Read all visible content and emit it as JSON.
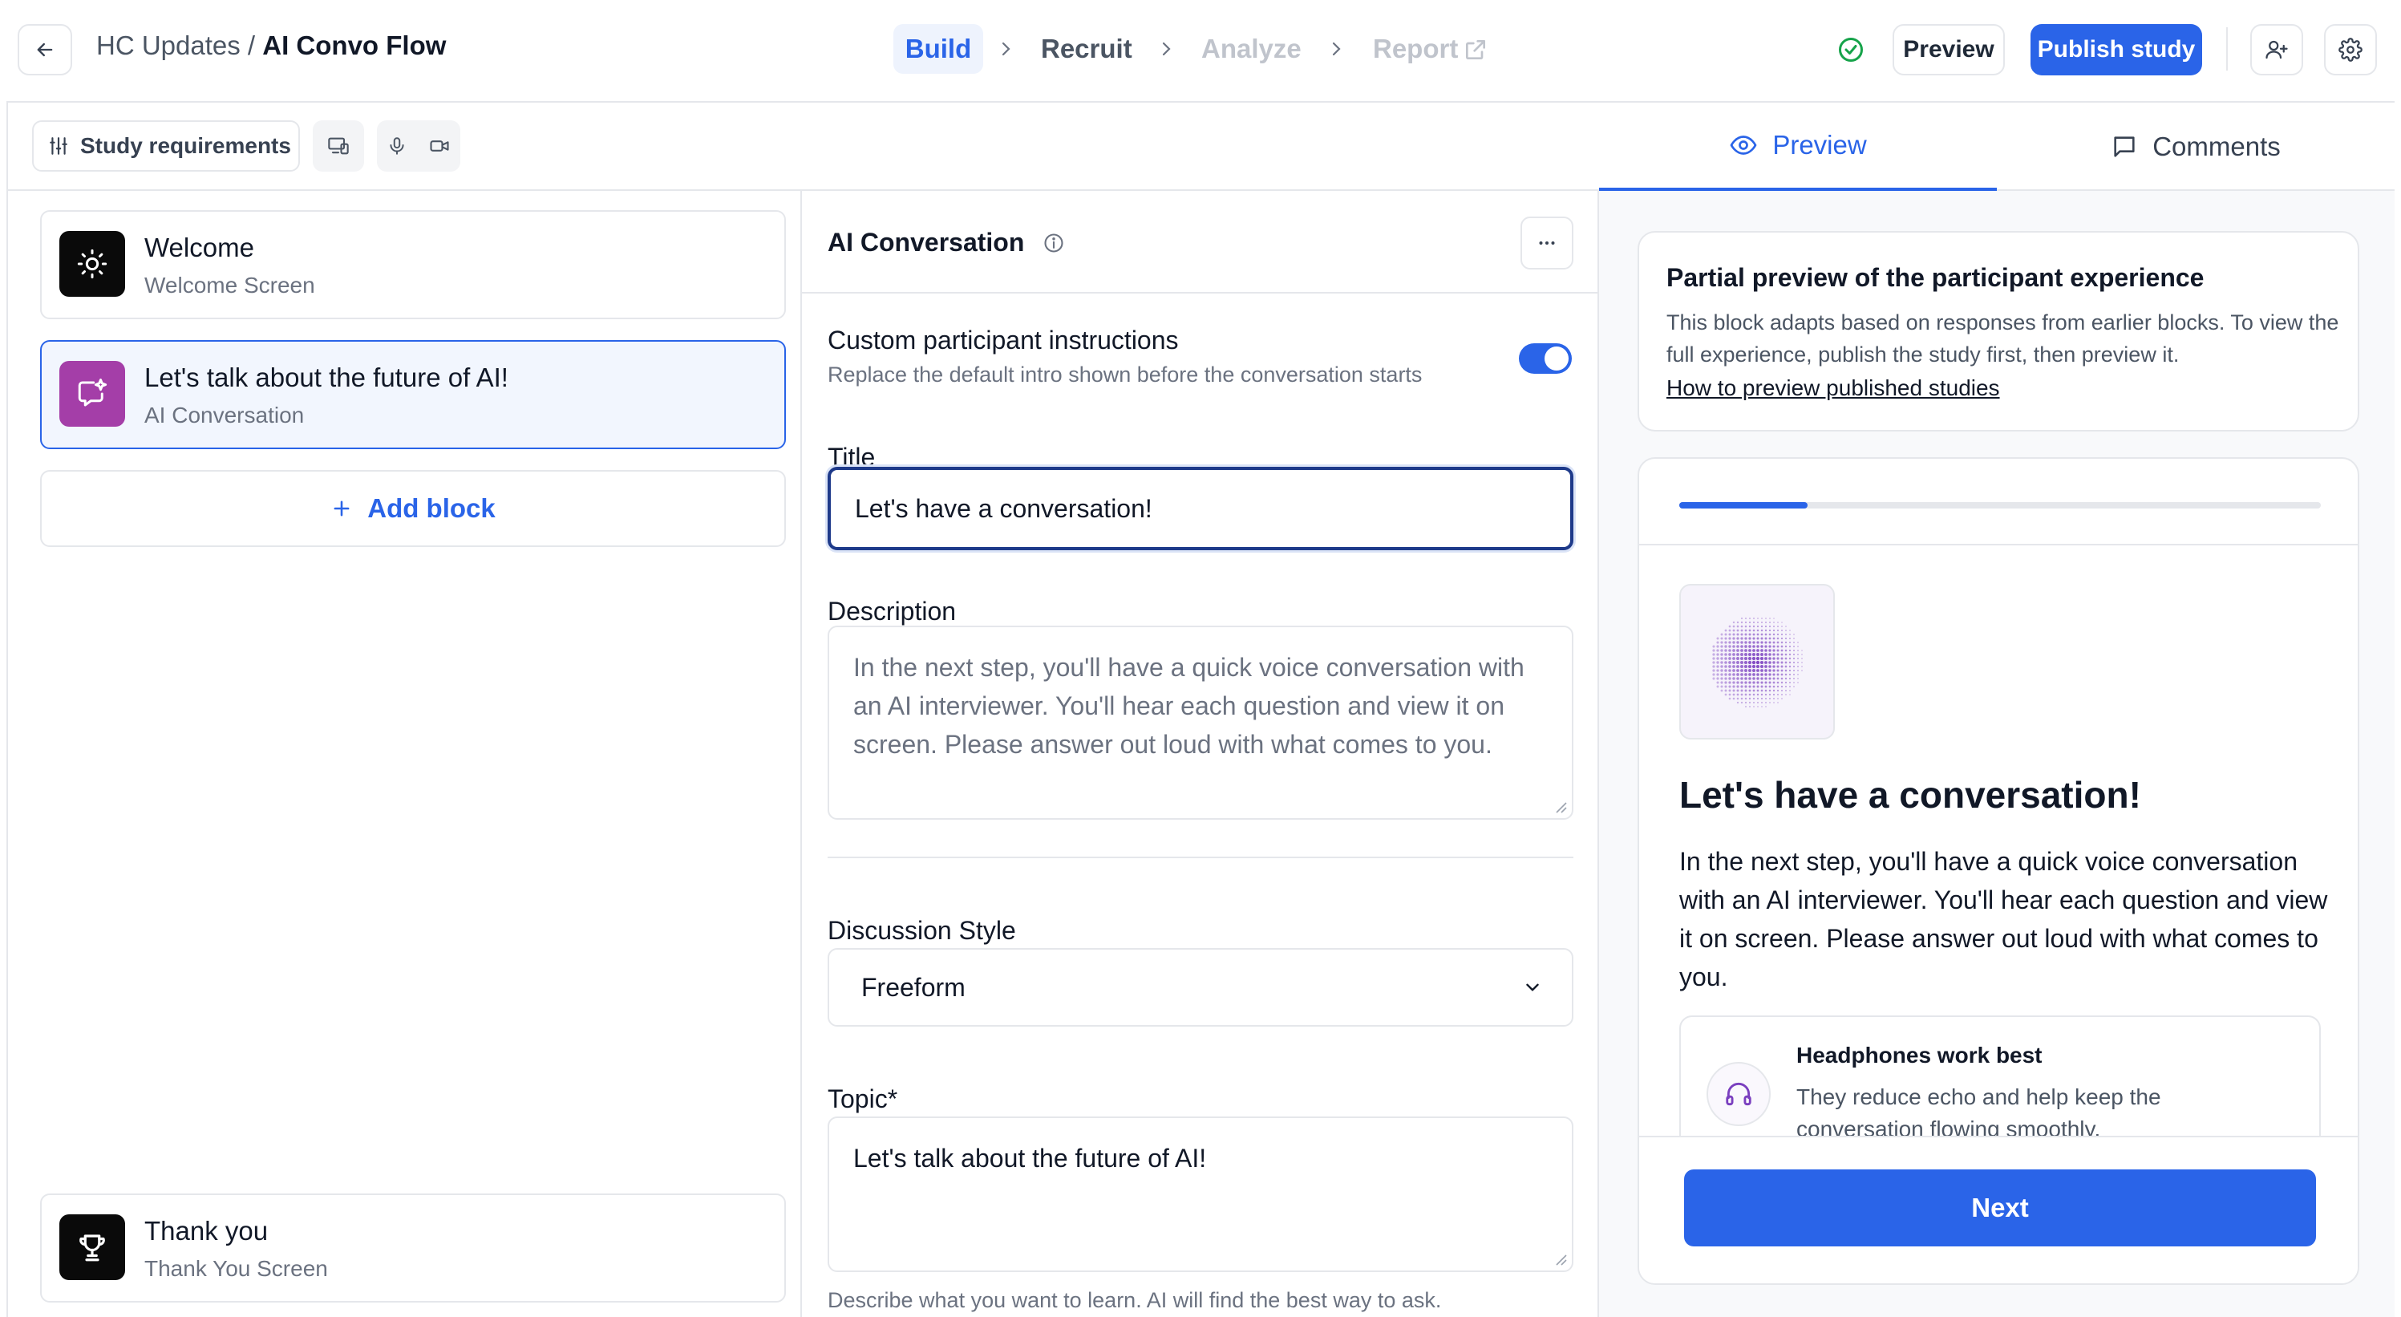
{
  "header": {
    "project": "HC Updates",
    "separator": " / ",
    "study": "AI Convo Flow",
    "steps": [
      {
        "label": "Build",
        "state": "active"
      },
      {
        "label": "Recruit",
        "state": "enabled"
      },
      {
        "label": "Analyze",
        "state": "disabled"
      },
      {
        "label": "Report",
        "state": "disabled"
      }
    ],
    "preview_label": "Preview",
    "publish_label": "Publish study",
    "icons": {
      "back": "arrow-left-icon",
      "saved": "check-circle-icon",
      "invite": "user-plus-icon",
      "settings": "gear-icon",
      "external": "external-link-icon",
      "chevron": "chevron-right-icon"
    }
  },
  "toolbar": {
    "requirements_label": "Study requirements",
    "icons": [
      "sliders-icon",
      "devices-icon",
      "microphone-icon",
      "camera-icon"
    ]
  },
  "blocks": [
    {
      "title": "Welcome",
      "subtitle": "Welcome Screen",
      "icon": "sun-icon",
      "icon_color": "#0a0a0a"
    },
    {
      "title": "Let's talk about the future of AI!",
      "subtitle": "AI Conversation",
      "icon": "sparkle-chat-icon",
      "icon_color": "#a43ea8",
      "selected": true
    },
    {
      "title": "Thank you",
      "subtitle": "Thank You Screen",
      "icon": "trophy-icon",
      "icon_color": "#0a0a0a"
    }
  ],
  "add_block_label": "Add block",
  "editor": {
    "title": "AI Conversation",
    "custom_instructions_label": "Custom participant instructions",
    "custom_instructions_hint": "Replace the default intro shown before the conversation starts",
    "custom_instructions_enabled": true,
    "title_label": "Title",
    "title_value": "Let's have a conversation!",
    "description_label": "Description",
    "description_placeholder": "In the next step, you'll have a quick voice conversation with an AI interviewer. You'll hear each question and view it on screen. Please answer out loud with what comes to you.",
    "discussion_style_label": "Discussion Style",
    "discussion_style_value": "Freeform",
    "topic_label": "Topic*",
    "topic_value": "Let's talk about the future of AI!",
    "topic_hint": "Describe what you want to learn. AI will find the best way to ask."
  },
  "preview_panel": {
    "tabs": [
      {
        "label": "Preview",
        "icon": "eye-icon",
        "active": true
      },
      {
        "label": "Comments",
        "icon": "comment-icon",
        "active": false
      }
    ],
    "info_title": "Partial preview of the participant experience",
    "info_text": "This block adapts based on responses from earlier blocks. To view the full experience, publish the study first, then preview it.",
    "info_link": "How to preview published studies",
    "progress": 0.2,
    "participant_title": "Let's have a conversation!",
    "participant_description": "In the next step, you'll have a quick voice conversation with an AI interviewer. You'll hear each question and view it on screen. Please answer out loud with what comes to you.",
    "tip_title": "Headphones work best",
    "tip_text": "They reduce echo and help keep the conversation flowing smoothly.",
    "next_label": "Next"
  },
  "colors": {
    "accent": "#2a64e8",
    "selected_block_bg": "#f2f6fe",
    "success": "#16a34a",
    "ai_purple": "#7a3fbf"
  }
}
